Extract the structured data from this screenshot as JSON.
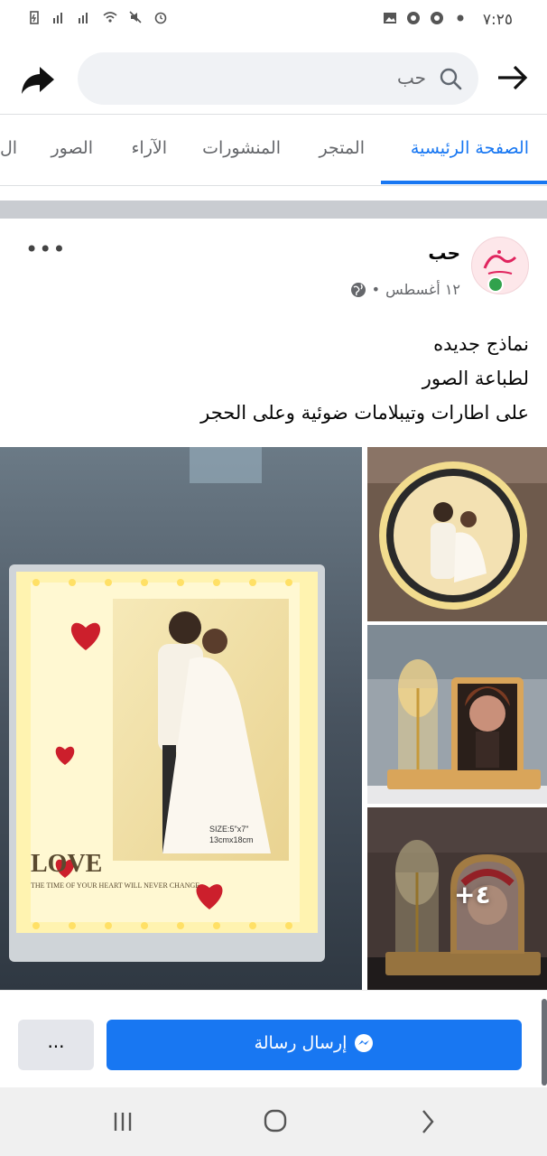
{
  "status_bar": {
    "time": "٧:٢٥"
  },
  "search": {
    "query": "حب"
  },
  "tabs": [
    {
      "label": "الصفحة الرئيسية",
      "active": true
    },
    {
      "label": "المتجر",
      "active": false
    },
    {
      "label": "المنشورات",
      "active": false
    },
    {
      "label": "الآراء",
      "active": false
    },
    {
      "label": "الصور",
      "active": false
    },
    {
      "label": "ال",
      "active": false
    }
  ],
  "post": {
    "author": "حب",
    "date": "١٢ أغسطس",
    "separator": "•",
    "text_lines": [
      "نماذج جديده",
      "لطباعة الصور",
      "على اطارات وتيبلامات ضوئية وعلى الحجر"
    ],
    "main_image_text": {
      "love": "LOVE",
      "size": "SIZE:5\"x7\"",
      "size_cm": "13cmx18cm",
      "caption": "THE TIME OF YOUR HEART WILL NEVER CHANGE"
    },
    "more_photos_label": "+٤"
  },
  "actions": {
    "send_message": "إرسال رسالة",
    "more": "..."
  },
  "colors": {
    "accent": "#1877f2",
    "online": "#31a24c"
  }
}
